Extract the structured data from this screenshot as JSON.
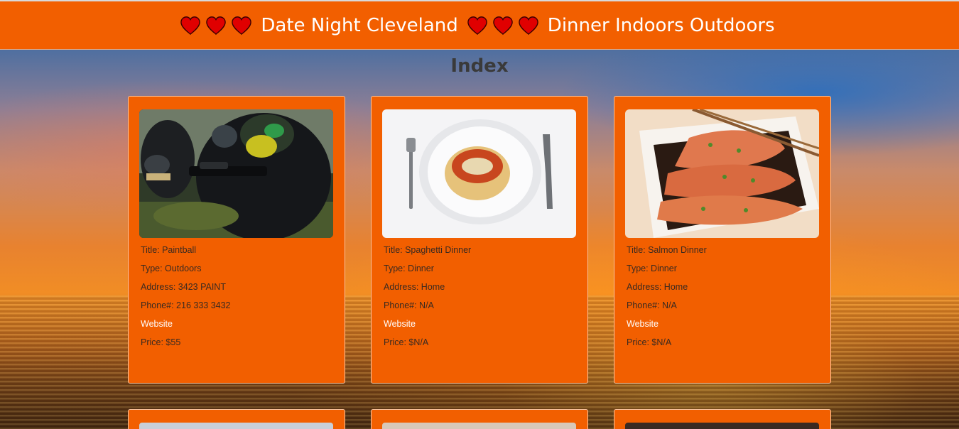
{
  "header": {
    "title": "Date Night Cleveland",
    "subtitle": "Dinner Indoors Outdoors"
  },
  "page_title": "Index",
  "cards": [
    {
      "title": "Title: Paintball",
      "type": "Type: Outdoors",
      "address": "Address: 3423 PAINT",
      "phone": "Phone#: 216 333 3432",
      "website": "Website",
      "price": "Price: $55",
      "image": "paintball-photo"
    },
    {
      "title": "Title: Spaghetti Dinner",
      "type": "Type: Dinner",
      "address": "Address: Home",
      "phone": "Phone#: N/A",
      "website": "Website",
      "price": "Price: $N/A",
      "image": "spaghetti-photo"
    },
    {
      "title": "Title: Salmon Dinner",
      "type": "Type: Dinner",
      "address": "Address: Home",
      "phone": "Phone#: N/A",
      "website": "Website",
      "price": "Price: $N/A",
      "image": "salmon-photo"
    }
  ],
  "colors": {
    "header_bg": "#f25f00",
    "card_bg": "#f25f00",
    "heart": "#e00000",
    "link": "#ffffff"
  },
  "icons": [
    "heart-icon"
  ]
}
